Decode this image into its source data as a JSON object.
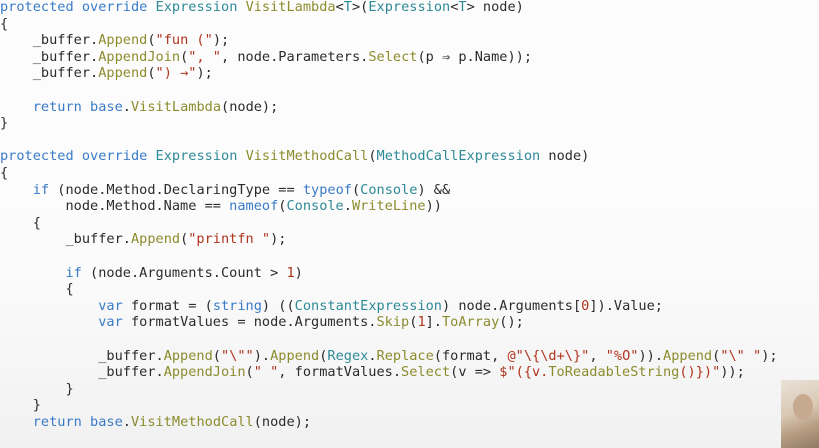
{
  "code": {
    "lines": [
      [
        [
          "kw",
          "protected"
        ],
        [
          "pl",
          " "
        ],
        [
          "kw",
          "override"
        ],
        [
          "pl",
          " "
        ],
        [
          "ty",
          "Expression"
        ],
        [
          "pl",
          " "
        ],
        [
          "fn",
          "VisitLambda"
        ],
        [
          "pl",
          "<"
        ],
        [
          "ty",
          "T"
        ],
        [
          "pl",
          ">("
        ],
        [
          "ty",
          "Expression"
        ],
        [
          "pl",
          "<"
        ],
        [
          "ty",
          "T"
        ],
        [
          "pl",
          "> node)"
        ]
      ],
      [
        [
          "pl",
          "{"
        ]
      ],
      [
        [
          "pl",
          "    _buffer."
        ],
        [
          "fn",
          "Append"
        ],
        [
          "pl",
          "("
        ],
        [
          "str",
          "\"fun (\""
        ],
        [
          "pl",
          ");"
        ]
      ],
      [
        [
          "pl",
          "    _buffer."
        ],
        [
          "fn",
          "AppendJoin"
        ],
        [
          "pl",
          "("
        ],
        [
          "str",
          "\", \""
        ],
        [
          "pl",
          ", node.Parameters."
        ],
        [
          "fn",
          "Select"
        ],
        [
          "pl",
          "(p ⇒ p.Name));"
        ]
      ],
      [
        [
          "pl",
          "    _buffer."
        ],
        [
          "fn",
          "Append"
        ],
        [
          "pl",
          "("
        ],
        [
          "str",
          "\") →\""
        ],
        [
          "pl",
          ");"
        ]
      ],
      [
        [
          "pl",
          ""
        ]
      ],
      [
        [
          "pl",
          "    "
        ],
        [
          "kw",
          "return"
        ],
        [
          "pl",
          " "
        ],
        [
          "kw",
          "base"
        ],
        [
          "pl",
          "."
        ],
        [
          "fn",
          "VisitLambda"
        ],
        [
          "pl",
          "(node);"
        ]
      ],
      [
        [
          "pl",
          "}"
        ]
      ],
      [
        [
          "pl",
          ""
        ]
      ],
      [
        [
          "kw",
          "protected"
        ],
        [
          "pl",
          " "
        ],
        [
          "kw",
          "override"
        ],
        [
          "pl",
          " "
        ],
        [
          "ty",
          "Expression"
        ],
        [
          "pl",
          " "
        ],
        [
          "fn",
          "VisitMethodCall"
        ],
        [
          "pl",
          "("
        ],
        [
          "ty",
          "MethodCallExpression"
        ],
        [
          "pl",
          " node)"
        ]
      ],
      [
        [
          "pl",
          "{"
        ]
      ],
      [
        [
          "pl",
          "    "
        ],
        [
          "kw",
          "if"
        ],
        [
          "pl",
          " (node.Method.DeclaringType == "
        ],
        [
          "kw",
          "typeof"
        ],
        [
          "pl",
          "("
        ],
        [
          "ty",
          "Console"
        ],
        [
          "pl",
          ") &&"
        ]
      ],
      [
        [
          "pl",
          "        node.Method.Name == "
        ],
        [
          "kw",
          "nameof"
        ],
        [
          "pl",
          "("
        ],
        [
          "ty",
          "Console"
        ],
        [
          "pl",
          "."
        ],
        [
          "fn",
          "WriteLine"
        ],
        [
          "pl",
          "))"
        ]
      ],
      [
        [
          "pl",
          "    {"
        ]
      ],
      [
        [
          "pl",
          "        _buffer."
        ],
        [
          "fn",
          "Append"
        ],
        [
          "pl",
          "("
        ],
        [
          "str",
          "\"printfn \""
        ],
        [
          "pl",
          ");"
        ]
      ],
      [
        [
          "pl",
          ""
        ]
      ],
      [
        [
          "pl",
          "        "
        ],
        [
          "kw",
          "if"
        ],
        [
          "pl",
          " (node.Arguments.Count > "
        ],
        [
          "num",
          "1"
        ],
        [
          "pl",
          ")"
        ]
      ],
      [
        [
          "pl",
          "        {"
        ]
      ],
      [
        [
          "pl",
          "            "
        ],
        [
          "kw",
          "var"
        ],
        [
          "pl",
          " format = ("
        ],
        [
          "kw",
          "string"
        ],
        [
          "pl",
          ") (("
        ],
        [
          "ty",
          "ConstantExpression"
        ],
        [
          "pl",
          ") node.Arguments["
        ],
        [
          "num",
          "0"
        ],
        [
          "pl",
          "]).Value;"
        ]
      ],
      [
        [
          "pl",
          "            "
        ],
        [
          "kw",
          "var"
        ],
        [
          "pl",
          " formatValues = node.Arguments."
        ],
        [
          "fn",
          "Skip"
        ],
        [
          "pl",
          "("
        ],
        [
          "num",
          "1"
        ],
        [
          "pl",
          "]."
        ],
        [
          "fn",
          "ToArray"
        ],
        [
          "pl",
          "();"
        ]
      ],
      [
        [
          "pl",
          ""
        ]
      ],
      [
        [
          "pl",
          "            _buffer."
        ],
        [
          "fn",
          "Append"
        ],
        [
          "pl",
          "("
        ],
        [
          "str",
          "\"\\\"\""
        ],
        [
          "pl",
          ")."
        ],
        [
          "fn",
          "Append"
        ],
        [
          "pl",
          "("
        ],
        [
          "ty",
          "Regex"
        ],
        [
          "pl",
          "."
        ],
        [
          "fn",
          "Replace"
        ],
        [
          "pl",
          "(format, "
        ],
        [
          "str",
          "@\"\\{\\d+\\}\""
        ],
        [
          "pl",
          ", "
        ],
        [
          "str",
          "\"%O\""
        ],
        [
          "pl",
          "))."
        ],
        [
          "fn",
          "Append"
        ],
        [
          "pl",
          "("
        ],
        [
          "str",
          "\"\\\" \""
        ],
        [
          "pl",
          ");"
        ]
      ],
      [
        [
          "pl",
          "            _buffer."
        ],
        [
          "fn",
          "AppendJoin"
        ],
        [
          "pl",
          "("
        ],
        [
          "str",
          "\" \""
        ],
        [
          "pl",
          ", formatValues."
        ],
        [
          "fn",
          "Select"
        ],
        [
          "pl",
          "(v => "
        ],
        [
          "str",
          "$\"({v."
        ],
        [
          "fn",
          "ToReadableString"
        ],
        [
          "str",
          "()})\""
        ],
        [
          "pl",
          "));"
        ]
      ],
      [
        [
          "pl",
          "        }"
        ]
      ],
      [
        [
          "pl",
          "    }"
        ]
      ],
      [
        [
          "pl",
          "    "
        ],
        [
          "kw",
          "return"
        ],
        [
          "pl",
          " "
        ],
        [
          "kw",
          "base"
        ],
        [
          "pl",
          "."
        ],
        [
          "fn",
          "VisitMethodCall"
        ],
        [
          "pl",
          "(node);"
        ]
      ]
    ]
  },
  "colors": {
    "keyword": "#3a7bc8",
    "type": "#2f8a97",
    "method": "#8c8c2e",
    "string": "#b0341e",
    "plain": "#2b2b2b",
    "background": "#fbfbfb"
  }
}
